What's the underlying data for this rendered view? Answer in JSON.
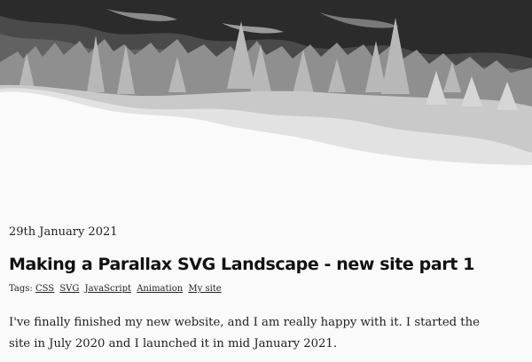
{
  "post": {
    "date": "29th January 2021",
    "title": "Making a Parallax SVG Landscape - new site part 1",
    "tags_label": "Tags:",
    "tags": [
      "CSS",
      "SVG",
      "JavaScript",
      "Animation",
      "My site"
    ],
    "intro": "I've finally finished my new website, and I am really happy with it. I started the site in July 2020 and I launched it in mid January 2021."
  }
}
